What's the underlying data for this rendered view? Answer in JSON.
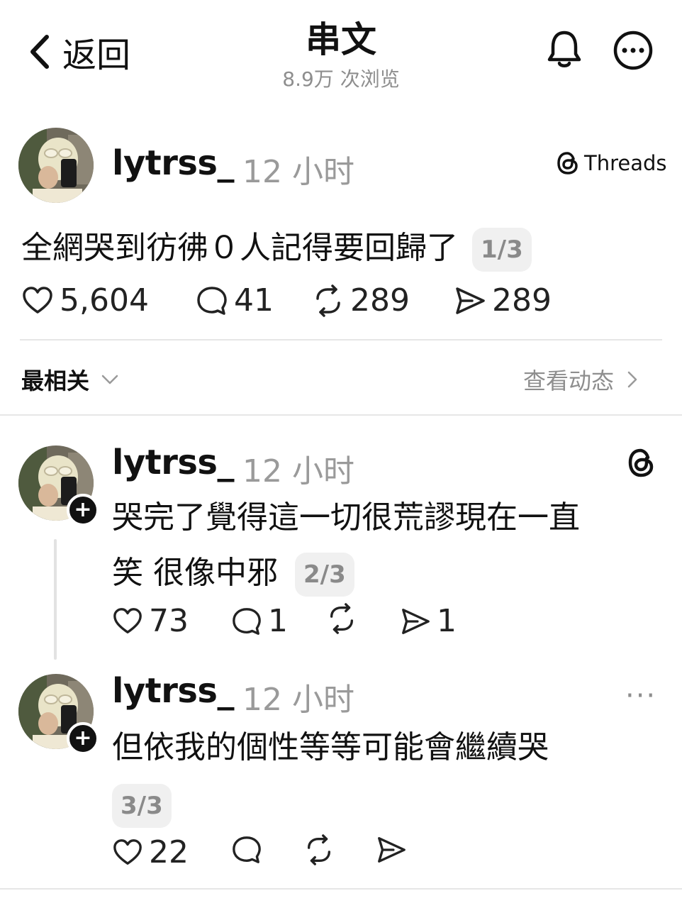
{
  "header": {
    "back_label": "返回",
    "title": "串文",
    "views": "8.9万 次浏览"
  },
  "post": {
    "username": "lytrss_",
    "time": "12 小时",
    "badge": "Threads",
    "text": "全網哭到彷彿０人記得要回歸了",
    "pager": "1/3",
    "likes": "5,604",
    "comments": "41",
    "reposts": "289",
    "shares": "289"
  },
  "sort": {
    "label": "最相关",
    "activity_label": "查看动态"
  },
  "replies": [
    {
      "username": "lytrss_",
      "time": "12 小时",
      "text_line1": "哭完了覺得這一切很荒謬現在一直",
      "text_line2": "笑 很像中邪",
      "pager": "2/3",
      "likes": "73",
      "comments": "1",
      "reposts": "",
      "shares": "1"
    },
    {
      "username": "lytrss_",
      "time": "12 小时",
      "text_line1": "但依我的個性等等可能會繼續哭",
      "pager": "3/3",
      "likes": "22",
      "more": "···"
    }
  ]
}
